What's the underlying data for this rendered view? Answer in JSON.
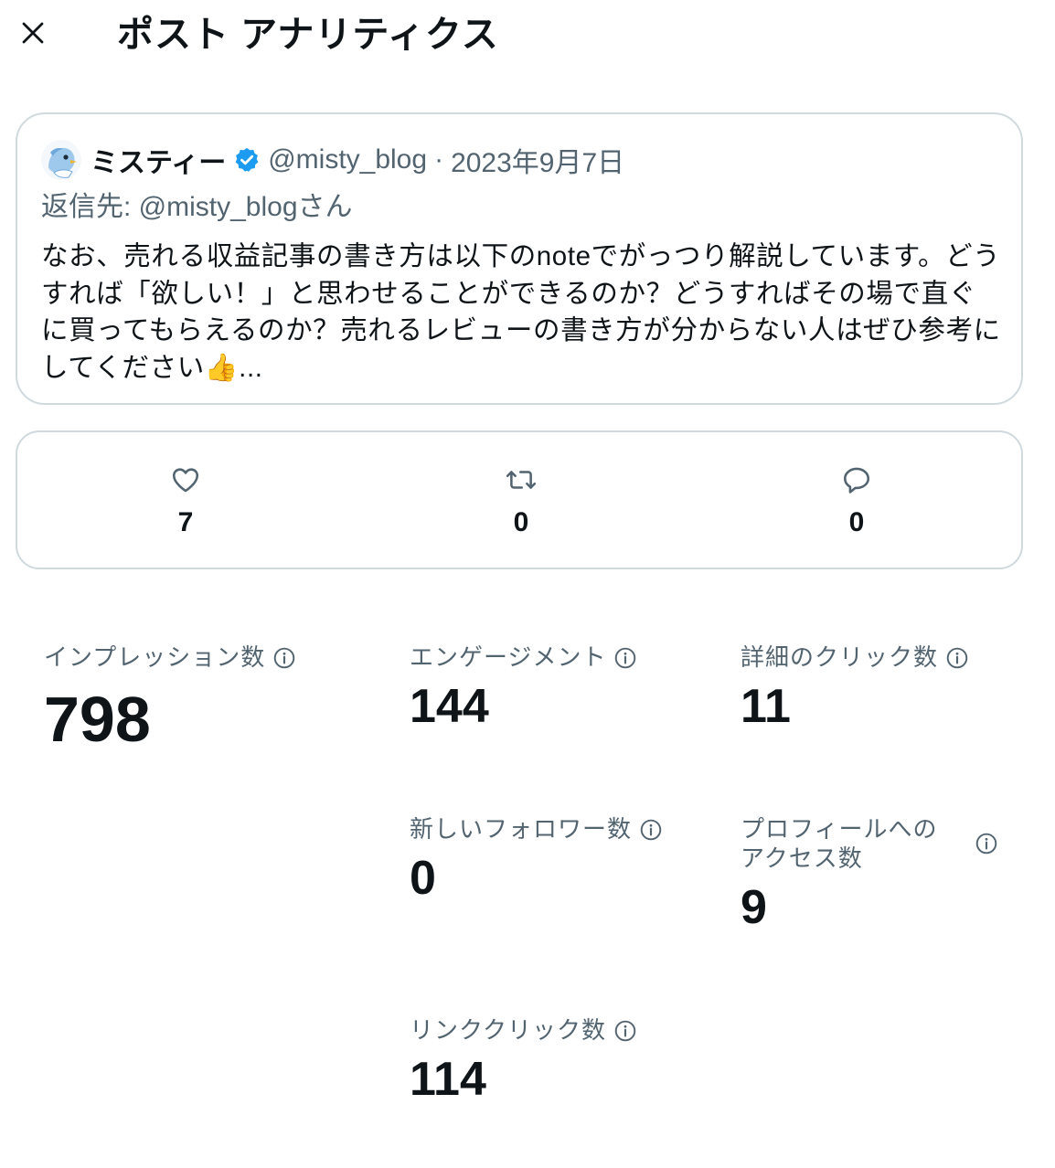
{
  "header": {
    "title": "ポスト アナリティクス"
  },
  "post": {
    "author_name": "ミスティー",
    "handle": "@misty_blog",
    "separator": "·",
    "date": "2023年9月7日",
    "reply_to": "返信先: @misty_blogさん",
    "text": "なお、売れる収益記事の書き方は以下のnoteでがっつり解説しています。どうすれば「欲しい！」と思わせることができるのか？どうすればその場で直ぐに買ってもらえるのか？売れるレビューの書き方が分からない人はぜひ参考にしてください👍..."
  },
  "engagement": {
    "likes": "7",
    "reposts": "0",
    "replies": "0"
  },
  "metrics": {
    "impressions": {
      "label": "インプレッション数",
      "value": "798"
    },
    "engagements": {
      "label": "エンゲージメント",
      "value": "144"
    },
    "detail_clicks": {
      "label": "詳細のクリック数",
      "value": "11"
    },
    "new_followers": {
      "label": "新しいフォロワー数",
      "value": "0"
    },
    "profile_visits": {
      "label": "プロフィールへのアクセス数",
      "value": "9"
    },
    "link_clicks": {
      "label": "リンククリック数",
      "value": "114"
    }
  },
  "icons": {
    "close": "close-icon",
    "verified": "verified-badge-icon",
    "like": "heart-icon",
    "repost": "repost-icon",
    "reply": "reply-bubble-icon",
    "info": "info-circle-icon"
  },
  "colors": {
    "text_primary": "#0f1419",
    "text_secondary": "#536471",
    "border": "#cfd9de",
    "verified_blue": "#1d9bf0"
  }
}
